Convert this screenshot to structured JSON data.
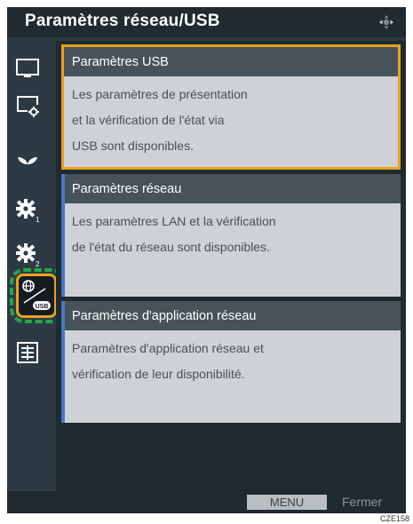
{
  "window": {
    "title": "Paramètres réseau/USB"
  },
  "sidebar": {
    "items": [
      {
        "icon": "display-icon",
        "selected": false
      },
      {
        "icon": "display-settings-icon",
        "selected": false
      },
      {
        "icon": "eco-leaf-icon",
        "selected": false
      },
      {
        "icon": "gear-1-icon",
        "selected": false
      },
      {
        "icon": "gear-2-icon",
        "selected": false
      },
      {
        "icon": "network-usb-icon",
        "selected": true,
        "usb_label": "USB"
      },
      {
        "icon": "info-panel-icon",
        "selected": false
      }
    ]
  },
  "cards": [
    {
      "title": "Paramètres USB",
      "lines": [
        "Les paramètres de présentation",
        "et la vérification de l'état via",
        "USB sont disponibles."
      ],
      "selected": true
    },
    {
      "title": "Paramètres réseau",
      "lines": [
        "Les paramètres LAN et la vérification",
        "de l'état du réseau sont disponibles."
      ],
      "selected": false
    },
    {
      "title": "Paramètres d'application réseau",
      "lines": [
        "Paramètres d'application réseau et",
        "vérification de leur disponibilité."
      ],
      "selected": false
    }
  ],
  "footer": {
    "menu_label": "MENU",
    "close_label": "Fermer"
  },
  "figure_code": "CZE158",
  "colors": {
    "accent_selected": "#e8a21e",
    "highlight_dashed": "#1ea84e",
    "card_accent": "#4b77c2"
  }
}
